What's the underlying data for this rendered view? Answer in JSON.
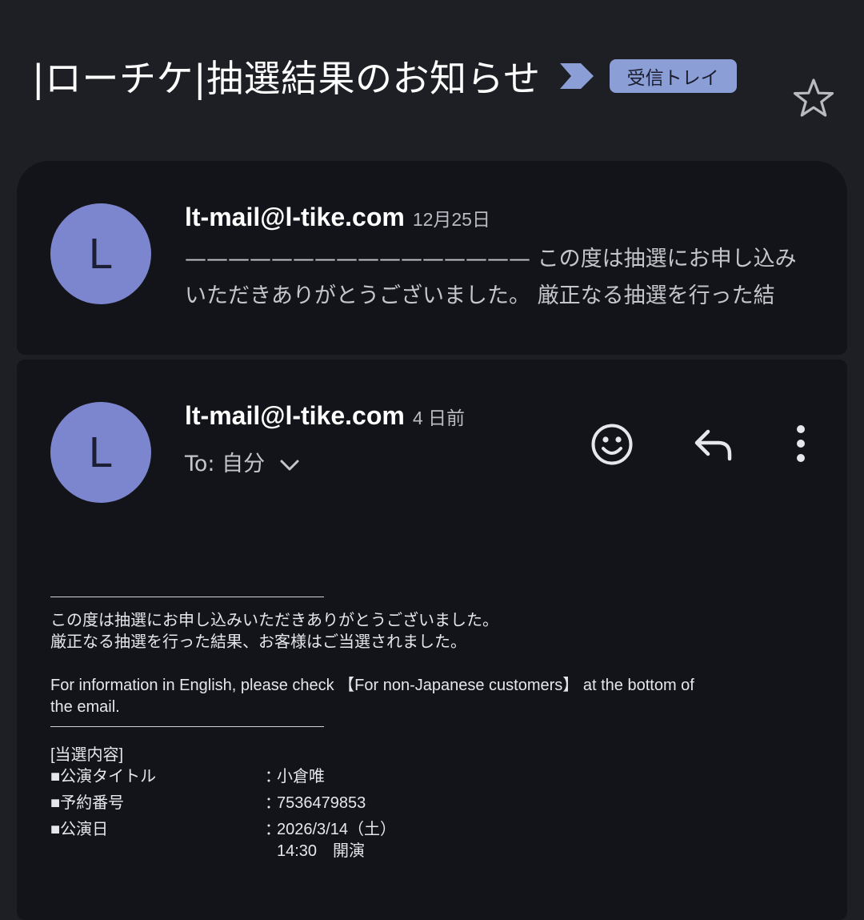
{
  "subject": "|ローチケ|抽選結果のお知らせ",
  "label_chip": "受信トレイ",
  "icons": {
    "importance": "importance-marker-icon",
    "star": "star-icon",
    "emoji": "emoji-icon",
    "reply": "reply-icon",
    "more": "more-vert-icon",
    "expand": "chevron-down-icon"
  },
  "colors": {
    "background": "#1e1f24",
    "card": "#131419",
    "avatar": "#7b86cf",
    "label_chip": "#8c9ed6"
  },
  "message_collapsed": {
    "avatar_letter": "L",
    "sender": "lt-mail@l-tike.com",
    "date": "12月25日",
    "snippet_lines": [
      "———————————————— この度は抽選にお申し込み",
      "いただきありがとうございました。 厳正なる抽選を行った結"
    ]
  },
  "message_expanded": {
    "avatar_letter": "L",
    "sender": "lt-mail@l-tike.com",
    "date": "4 日前",
    "recipient": "To: 自分",
    "body": {
      "intro_1": "この度は抽選にお申し込みいただきありがとうございました。",
      "intro_2": "厳正なる抽選を行った結果、お客様はご当選されました。",
      "english_1": "For information in English, please check 【For non-Japanese customers】 at the bottom of",
      "english_2": "the email.",
      "section_title": "[当選内容]",
      "fields": [
        {
          "key": "■公演タイトル",
          "sep": "：",
          "value": "小倉唯"
        },
        {
          "key": "■予約番号",
          "sep": "：",
          "value": "7536479853"
        },
        {
          "key": "■公演日",
          "sep": "：",
          "value": "2026/3/14（土）"
        }
      ],
      "time": "14:30　開演"
    }
  }
}
